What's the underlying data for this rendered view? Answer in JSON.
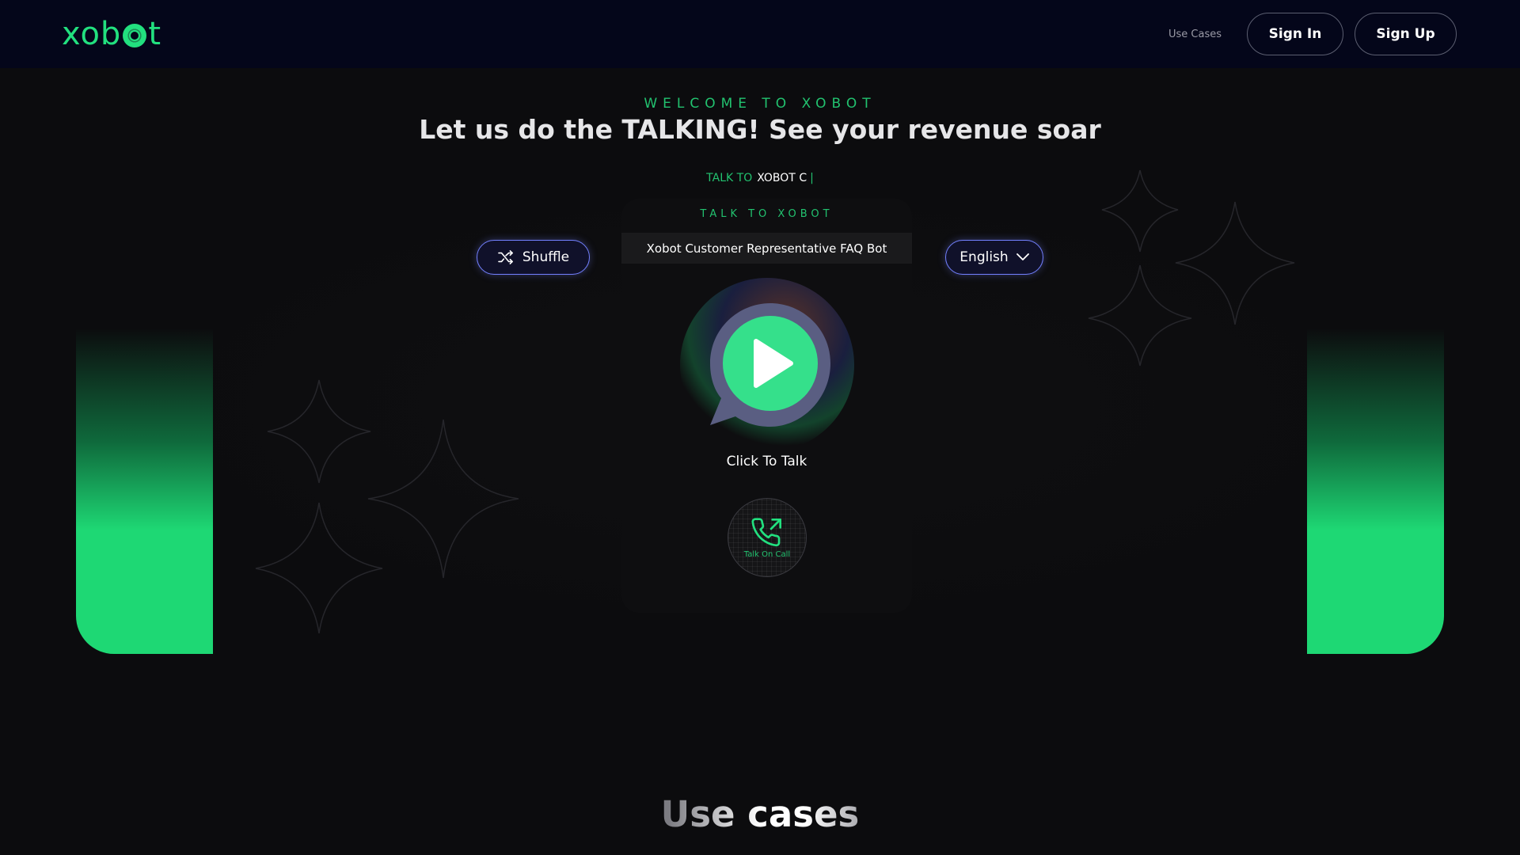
{
  "header": {
    "logo": "xobot",
    "nav_use_cases": "Use Cases",
    "sign_in": "Sign In",
    "sign_up": "Sign Up"
  },
  "hero": {
    "welcome": "WELCOME TO XOBOT",
    "headline": "Let us do the TALKING! See your revenue soar",
    "talk_to_prefix": "TALK TO",
    "talk_to_value": "XOBOT C",
    "caret": "|"
  },
  "card": {
    "title": "TALK TO XOBOT",
    "bot_name": "Xobot Customer Representative FAQ Bot",
    "click_label": "Click To Talk",
    "call_label": "Talk On Call"
  },
  "controls": {
    "shuffle_label": "Shuffle",
    "language_selected": "English"
  },
  "sections": {
    "use_cases_title": "Use cases"
  },
  "icons": {
    "shuffle": "shuffle-icon",
    "chevron": "chevron-down-icon",
    "play": "play-icon",
    "phone": "phone-outgoing-icon"
  },
  "colors": {
    "accent": "#22e07f",
    "header_bg": "#04061a",
    "page_bg": "#0c0c0e",
    "pill_border": "#7380ff"
  }
}
